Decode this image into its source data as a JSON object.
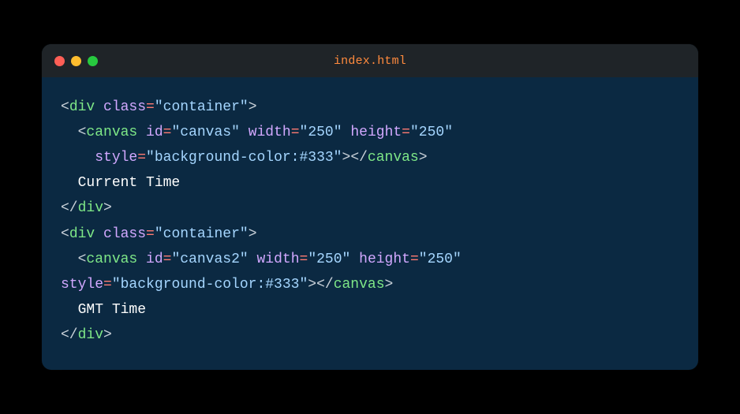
{
  "window": {
    "title": "index.html",
    "title_color": "#ff8a3d",
    "traffic": {
      "red": "#ff5f56",
      "yellow": "#ffbd2e",
      "green": "#27c93f"
    }
  },
  "code": {
    "lines": [
      {
        "indent": 0,
        "parts": [
          {
            "t": "punct",
            "v": "<"
          },
          {
            "t": "tag",
            "v": "div"
          },
          {
            "t": "punct",
            "v": " "
          },
          {
            "t": "attr",
            "v": "class"
          },
          {
            "t": "eq",
            "v": "="
          },
          {
            "t": "string",
            "v": "\"container\""
          },
          {
            "t": "punct",
            "v": ">"
          }
        ]
      },
      {
        "indent": 1,
        "parts": [
          {
            "t": "punct",
            "v": "<"
          },
          {
            "t": "tag",
            "v": "canvas"
          },
          {
            "t": "punct",
            "v": " "
          },
          {
            "t": "attr",
            "v": "id"
          },
          {
            "t": "eq",
            "v": "="
          },
          {
            "t": "string",
            "v": "\"canvas\""
          },
          {
            "t": "punct",
            "v": " "
          },
          {
            "t": "attr",
            "v": "width"
          },
          {
            "t": "eq",
            "v": "="
          },
          {
            "t": "string",
            "v": "\"250\""
          },
          {
            "t": "punct",
            "v": " "
          },
          {
            "t": "attr",
            "v": "height"
          },
          {
            "t": "eq",
            "v": "="
          },
          {
            "t": "string",
            "v": "\"250\""
          }
        ]
      },
      {
        "indent": 2,
        "parts": [
          {
            "t": "attr",
            "v": "style"
          },
          {
            "t": "eq",
            "v": "="
          },
          {
            "t": "string",
            "v": "\"background-color:#333\""
          },
          {
            "t": "punct",
            "v": ">"
          },
          {
            "t": "punct",
            "v": "</"
          },
          {
            "t": "tag",
            "v": "canvas"
          },
          {
            "t": "punct",
            "v": ">"
          }
        ]
      },
      {
        "indent": 1,
        "parts": [
          {
            "t": "text",
            "v": "Current Time"
          }
        ]
      },
      {
        "indent": 0,
        "parts": [
          {
            "t": "punct",
            "v": "</"
          },
          {
            "t": "tag",
            "v": "div"
          },
          {
            "t": "punct",
            "v": ">"
          }
        ]
      },
      {
        "indent": 0,
        "parts": [
          {
            "t": "punct",
            "v": "<"
          },
          {
            "t": "tag",
            "v": "div"
          },
          {
            "t": "punct",
            "v": " "
          },
          {
            "t": "attr",
            "v": "class"
          },
          {
            "t": "eq",
            "v": "="
          },
          {
            "t": "string",
            "v": "\"container\""
          },
          {
            "t": "punct",
            "v": ">"
          }
        ]
      },
      {
        "indent": 1,
        "parts": [
          {
            "t": "punct",
            "v": "<"
          },
          {
            "t": "tag",
            "v": "canvas"
          },
          {
            "t": "punct",
            "v": " "
          },
          {
            "t": "attr",
            "v": "id"
          },
          {
            "t": "eq",
            "v": "="
          },
          {
            "t": "string",
            "v": "\"canvas2\""
          },
          {
            "t": "punct",
            "v": " "
          },
          {
            "t": "attr",
            "v": "width"
          },
          {
            "t": "eq",
            "v": "="
          },
          {
            "t": "string",
            "v": "\"250\""
          },
          {
            "t": "punct",
            "v": " "
          },
          {
            "t": "attr",
            "v": "height"
          },
          {
            "t": "eq",
            "v": "="
          },
          {
            "t": "string",
            "v": "\"250\""
          }
        ]
      },
      {
        "indent": 0,
        "parts": [
          {
            "t": "attr",
            "v": "style"
          },
          {
            "t": "eq",
            "v": "="
          },
          {
            "t": "string",
            "v": "\"background-color:#333\""
          },
          {
            "t": "punct",
            "v": ">"
          },
          {
            "t": "punct",
            "v": "</"
          },
          {
            "t": "tag",
            "v": "canvas"
          },
          {
            "t": "punct",
            "v": ">"
          }
        ]
      },
      {
        "indent": 1,
        "parts": [
          {
            "t": "text",
            "v": "GMT Time"
          }
        ]
      },
      {
        "indent": 0,
        "parts": [
          {
            "t": "punct",
            "v": "</"
          },
          {
            "t": "tag",
            "v": "div"
          },
          {
            "t": "punct",
            "v": ">"
          }
        ]
      }
    ],
    "indent_unit": "  "
  }
}
